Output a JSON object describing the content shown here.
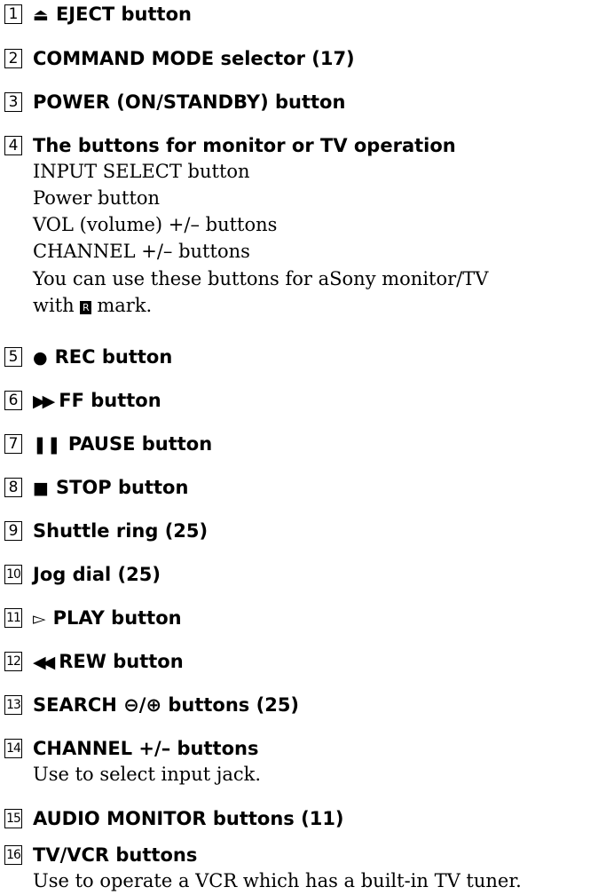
{
  "items": [
    {
      "num": "1",
      "symbol": "⏏",
      "label": "EJECT button"
    },
    {
      "num": "2",
      "label": "COMMAND MODE selector (17)"
    },
    {
      "num": "3",
      "label": "POWER (ON/STANDBY) button"
    },
    {
      "num": "4",
      "label": "The buttons for monitor or TV operation",
      "lines": [
        "INPUT SELECT button",
        "Power button",
        "VOL (volume) +/– buttons",
        "CHANNEL +/– buttons",
        "You can use these buttons for aSony monitor/TV"
      ],
      "last_line_pre": "with",
      "mark_symbol": "R",
      "last_line_post": "mark."
    },
    {
      "num": "5",
      "symbol": "●",
      "label": "REC button"
    },
    {
      "num": "6",
      "symbol": "▶▶",
      "label": "FF button"
    },
    {
      "num": "7",
      "symbol": "❚❚",
      "label": "PAUSE button"
    },
    {
      "num": "8",
      "symbol": "■",
      "label": "STOP button"
    },
    {
      "num": "9",
      "label": "Shuttle ring (25)"
    },
    {
      "num": "10",
      "label": "Jog dial (25)"
    },
    {
      "num": "11",
      "symbol": "▻",
      "label": "PLAY button"
    },
    {
      "num": "12",
      "symbol": "◀◀",
      "label": "REW button"
    },
    {
      "num": "13",
      "label": "SEARCH ⊖/⊕ buttons (25)"
    },
    {
      "num": "14",
      "label": "CHANNEL +/– buttons",
      "lines": [
        "Use to select input jack."
      ]
    },
    {
      "num": "15",
      "label": "AUDIO MONITOR buttons (11)"
    },
    {
      "num": "16",
      "label": "TV/VCR buttons",
      "lines": [
        "Use to operate a VCR which has a built-in TV tuner."
      ]
    }
  ]
}
